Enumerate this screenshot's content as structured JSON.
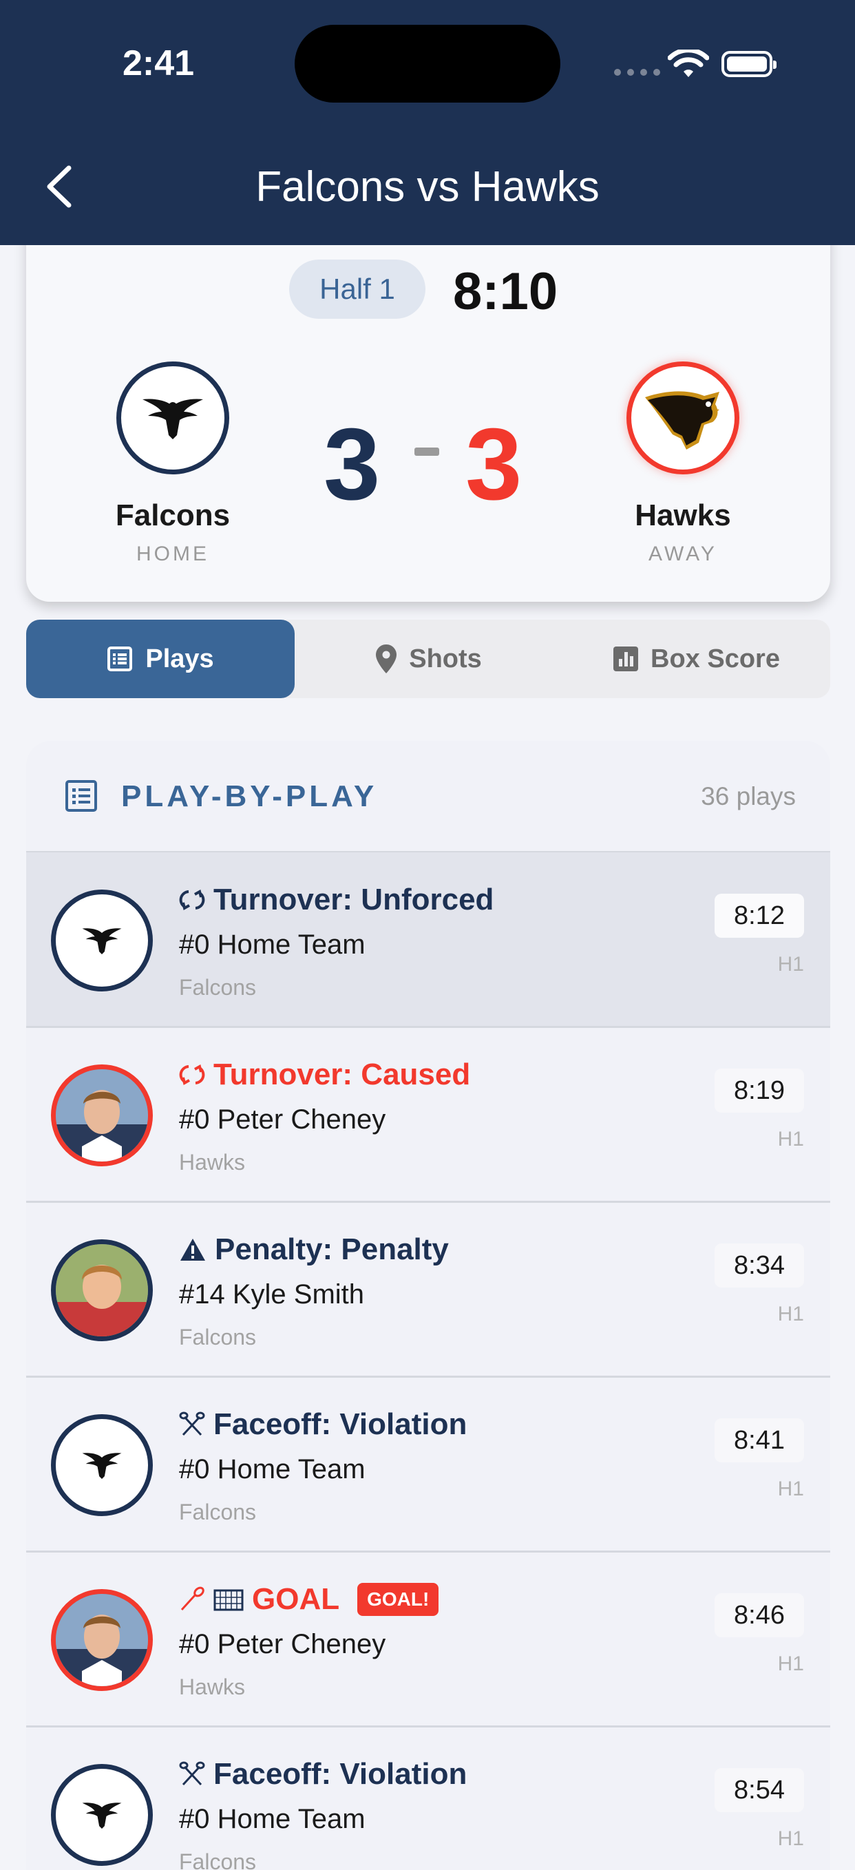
{
  "status_bar": {
    "time": "2:41"
  },
  "nav": {
    "title": "Falcons vs Hawks",
    "back_icon": "chevron-left-icon"
  },
  "scoreboard": {
    "period": "Half 1",
    "clock": "8:10",
    "home": {
      "name": "Falcons",
      "label": "HOME",
      "score": "3",
      "color": "#1d3153"
    },
    "away": {
      "name": "Hawks",
      "label": "AWAY",
      "score": "3",
      "color": "#f2392d"
    }
  },
  "tabs": [
    {
      "label": "Plays",
      "icon": "list-icon",
      "active": true
    },
    {
      "label": "Shots",
      "icon": "map-pin-icon",
      "active": false
    },
    {
      "label": "Box Score",
      "icon": "bar-chart-icon",
      "active": false
    }
  ],
  "pbp": {
    "title": "PLAY-BY-PLAY",
    "count": "36 plays",
    "plays": [
      {
        "type": "Turnover: Unforced",
        "player": "#0 Home Team",
        "team": "Falcons",
        "time": "8:12",
        "half": "H1",
        "icon": "turnover-icon"
      },
      {
        "type": "Turnover: Caused",
        "player": "#0 Peter Cheney",
        "team": "Hawks",
        "time": "8:19",
        "half": "H1",
        "icon": "turnover-icon"
      },
      {
        "type": "Penalty: Penalty",
        "player": "#14 Kyle Smith",
        "team": "Falcons",
        "time": "8:34",
        "half": "H1",
        "icon": "warning-icon"
      },
      {
        "type": "Faceoff: Violation",
        "player": "#0 Home Team",
        "team": "Falcons",
        "time": "8:41",
        "half": "H1",
        "icon": "crossed-sticks-icon"
      },
      {
        "type": "GOAL",
        "badge": "GOAL!",
        "player": "#0 Peter Cheney",
        "team": "Hawks",
        "time": "8:46",
        "half": "H1",
        "icon": "lacrosse-stick-icon"
      },
      {
        "type": "Faceoff: Violation",
        "player": "#0 Home Team",
        "team": "Falcons",
        "time": "8:54",
        "half": "H1",
        "icon": "crossed-sticks-icon"
      }
    ]
  }
}
